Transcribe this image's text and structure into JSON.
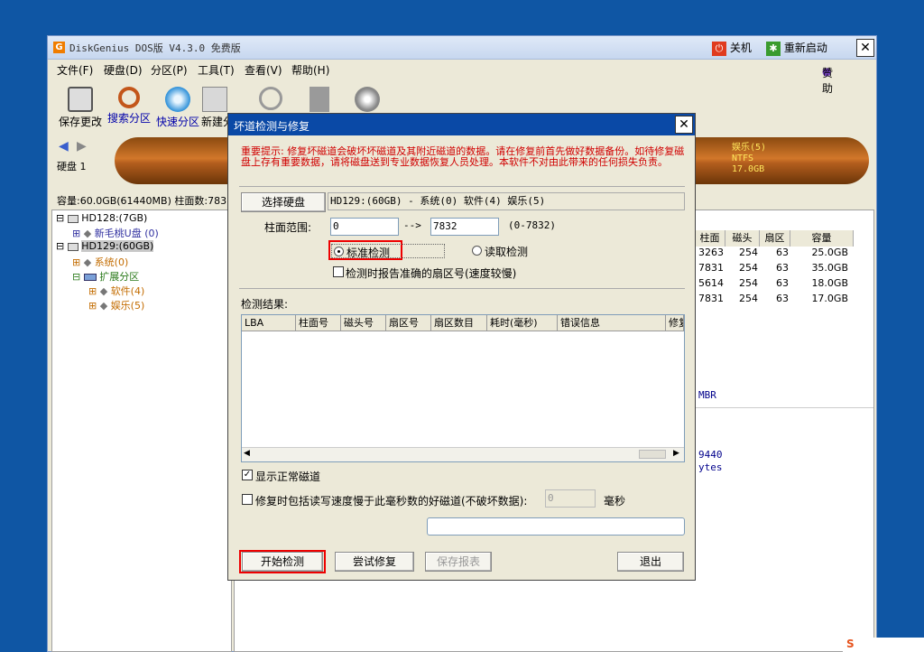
{
  "app": {
    "title": "DiskGenius DOS版 V4.3.0 免费版",
    "icon_letter": "G",
    "shutdown_label": "关机",
    "restart_label": "重新启动",
    "sponsor_label": "赞助"
  },
  "menu": [
    "文件(F)",
    "硬盘(D)",
    "分区(P)",
    "工具(T)",
    "查看(V)",
    "帮助(H)"
  ],
  "toolbar": [
    "保存更改",
    "搜索分区",
    "快速分区",
    "新建分"
  ],
  "disk": {
    "label": "硬盘 1",
    "info": "容量:60.0GB(61440MB)  柱面数:783",
    "partition_name": "娱乐(5)",
    "partition_fs": "NTFS",
    "partition_size": "17.0GB"
  },
  "tree": [
    {
      "label": "HD128:(7GB)"
    },
    {
      "label": "新毛桃U盘 (0)"
    },
    {
      "label": "HD129:(60GB)"
    },
    {
      "label": "系统(0)"
    },
    {
      "label": "扩展分区"
    },
    {
      "label": "软件(4)"
    },
    {
      "label": "娱乐(5)"
    }
  ],
  "partition_table": {
    "headers": [
      "柱面",
      "磁头",
      "扇区",
      "容量"
    ],
    "rows": [
      [
        "3263",
        "254",
        "63",
        "25.0GB"
      ],
      [
        "7831",
        "254",
        "63",
        "35.0GB"
      ],
      [
        "5614",
        "254",
        "63",
        "18.0GB"
      ],
      [
        "7831",
        "254",
        "63",
        "17.0GB"
      ]
    ],
    "mbr_label": "MBR",
    "fragment1": "9440",
    "fragment2": "ytes"
  },
  "dialog": {
    "title": "坏道检测与修复",
    "warning": "重要提示: 修复坏磁道会破坏坏磁道及其附近磁道的数据。请在修复前首先做好数据备份。如待修复磁盘上存有重要数据，请将磁盘送到专业数据恢复人员处理。本软件不对由此带来的任何损失负责。",
    "select_disk_label": "选择硬盘",
    "selected_disk": "HD129:(60GB) - 系统(0) 软件(4) 娱乐(5)",
    "range_label": "柱面范围:",
    "range_from": "0",
    "range_arrow": "-->",
    "range_to": "7832",
    "range_hint": "(0-7832)",
    "standard_check_label": "标准检测",
    "read_check_label": "读取检测",
    "report_sector_label": "检测时报告准确的扇区号(速度较慢)",
    "results_label": "检测结果:",
    "columns": [
      "LBA",
      "柱面号",
      "磁头号",
      "扇区号",
      "扇区数目",
      "耗时(毫秒)",
      "错误信息",
      "修复"
    ],
    "show_normal_label": "显示正常磁道",
    "repair_slow_label": "修复时包括读写速度慢于此毫秒数的好磁道(不破坏数据):",
    "repair_ms_value": "0",
    "ms_unit": "毫秒",
    "status_text": "",
    "start_button": "开始检测",
    "try_repair_button": "尝试修复",
    "save_report_button": "保存报表",
    "exit_button": "退出"
  }
}
